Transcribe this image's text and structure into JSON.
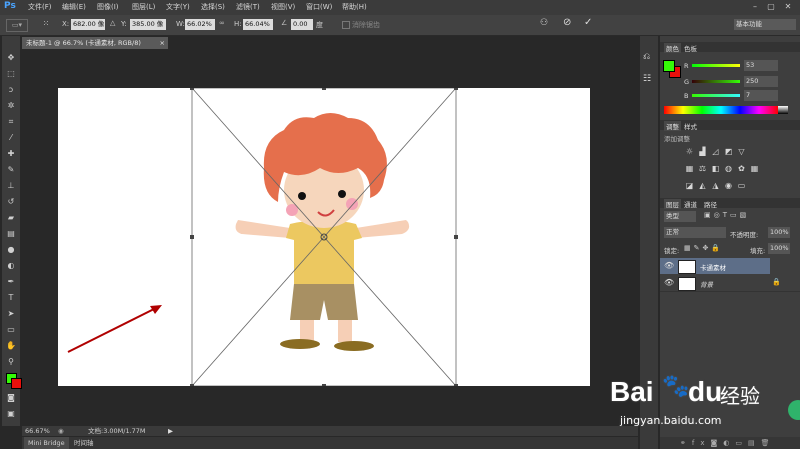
{
  "app": {
    "logo": "Ps"
  },
  "menu": [
    "文件(F)",
    "编辑(E)",
    "图像(I)",
    "图层(L)",
    "文字(Y)",
    "选择(S)",
    "滤镜(T)",
    "视图(V)",
    "窗口(W)",
    "帮助(H)"
  ],
  "window_controls": [
    "–",
    "▢",
    "✕"
  ],
  "options": {
    "x_label": "X:",
    "x_value": "682.00 像",
    "y_label": "Y:",
    "y_value": "385.00 像",
    "w_label": "W:",
    "w_value": "66.02%",
    "h_label": "H:",
    "h_value": "66.04%",
    "angle_value": "0.00",
    "angle_unit": "度",
    "antialias_label": "消除锯齿",
    "workspace": "基本功能"
  },
  "document": {
    "tab_title": "未标题-1 @ 66.7% (卡通素材, RGB/8)",
    "tab_close": "×"
  },
  "status": {
    "zoom": "66.67%",
    "doc_info": "文档:3.00M/1.77M"
  },
  "bottom_tabs": [
    "Mini Bridge",
    "时间轴"
  ],
  "color_panel": {
    "tabs": [
      "颜色",
      "色板"
    ],
    "r_label": "R",
    "r_value": "53",
    "g_label": "G",
    "g_value": "250",
    "b_label": "B",
    "b_value": "7",
    "foreground": "#35fa07",
    "background": "#e8100c"
  },
  "adjust_panel": {
    "tabs": [
      "调整",
      "样式"
    ],
    "hint": "添加调整"
  },
  "layers_panel": {
    "tabs": [
      "图层",
      "通道",
      "路径"
    ],
    "kind_label": "类型",
    "blend_mode": "正常",
    "opacity_label": "不透明度:",
    "opacity_value": "100%",
    "lock_label": "锁定:",
    "fill_label": "填充:",
    "fill_value": "100%",
    "layers": [
      {
        "name": "卡通素材",
        "selected": true
      },
      {
        "name": "背景",
        "selected": false
      }
    ]
  },
  "watermark": {
    "brand": "Bai",
    "brand2": "du",
    "brand3": "经验",
    "url": "jingyan.baidu.com"
  },
  "colors": {
    "accent": "#4aa4ff",
    "arrow": "#b00000"
  }
}
